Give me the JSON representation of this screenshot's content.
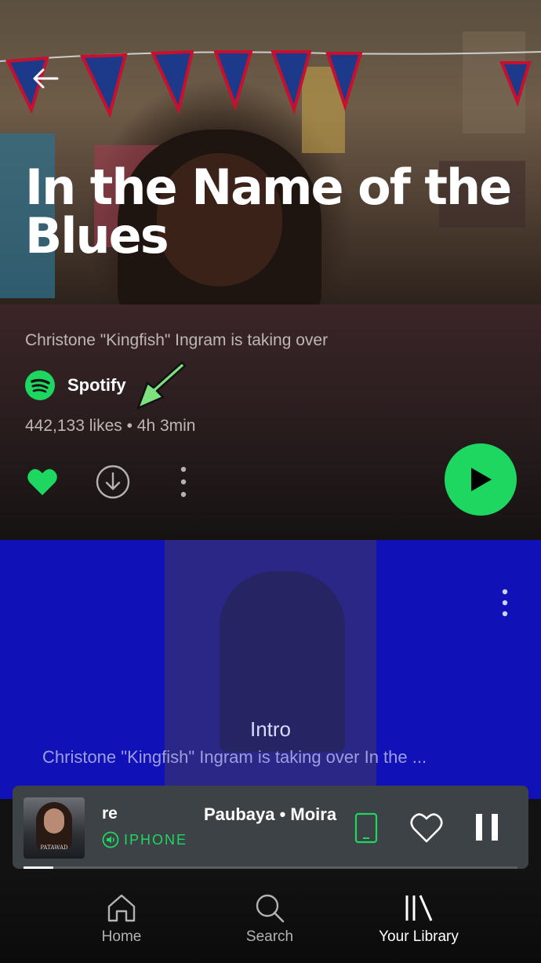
{
  "playlist": {
    "title": "In the Name of the Blues",
    "description": "Christone \"Kingfish\" Ingram is taking over",
    "owner": "Spotify",
    "meta": "442,133 likes • 4h 3min"
  },
  "track_card": {
    "title": "Intro",
    "subtitle": "Christone \"Kingfish\" Ingram is taking over In the ..."
  },
  "now_playing": {
    "artist_fragment": "re",
    "song": "Paubaya • Moira",
    "device": "IPHONE",
    "art_label": "PATAWAD",
    "progress": 0.06
  },
  "nav": {
    "home": "Home",
    "search": "Search",
    "library": "Your Library"
  },
  "colors": {
    "accent": "#1ed760",
    "card_blue": "#1111b8",
    "header_maroon": "#3b2527"
  }
}
